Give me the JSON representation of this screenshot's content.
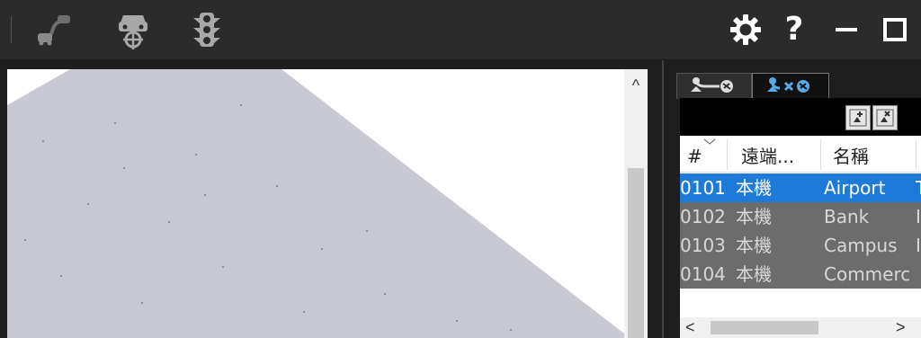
{
  "toolbar": {
    "icons": [
      "route-car-icon",
      "car-target-icon",
      "traffic-light-icon"
    ],
    "help_label": "?"
  },
  "tabs": [
    {
      "icon": "node-remote-icon",
      "active": false
    },
    {
      "icon": "node-disconnect-icon",
      "active": true
    }
  ],
  "table": {
    "headers": [
      "#",
      "遠端...",
      "名稱"
    ],
    "rows": [
      {
        "id": "0101",
        "remote": "本機",
        "name": "Airport",
        "extra": "T",
        "selected": true
      },
      {
        "id": "0102",
        "remote": "本機",
        "name": "Bank",
        "extra": "I",
        "selected": false
      },
      {
        "id": "0103",
        "remote": "本機",
        "name": "Campus",
        "extra": "I",
        "selected": false
      },
      {
        "id": "0104",
        "remote": "本機",
        "name": "Commerc",
        "extra": "",
        "selected": false
      }
    ]
  },
  "scroll": {
    "up": "^",
    "left": "<",
    "right": ">"
  },
  "colors": {
    "selected_row": "#1e7ad8",
    "toolbar_bg": "#2b2b2b",
    "terrain": "#c9c9d3"
  }
}
